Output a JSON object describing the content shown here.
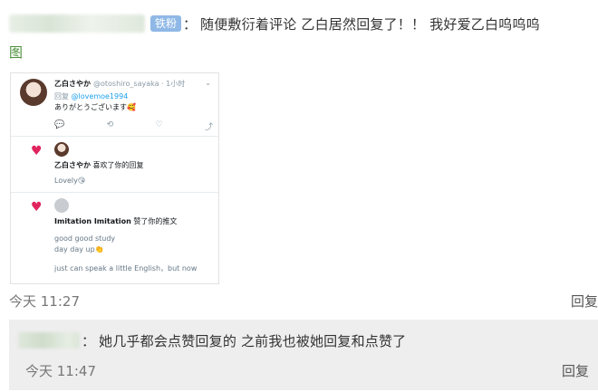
{
  "comment": {
    "badge": "铁粉",
    "colon": "：",
    "text": "随便敷衍着评论 乙白居然回复了！！ 我好爱乙白呜呜呜",
    "pic_link": "图",
    "time": "今天 11:27",
    "reply_label": "回复"
  },
  "tweet": {
    "name": "乙白さやか",
    "handle": "@otoshiro_sayaka · 1小时",
    "chevron": "⌄",
    "reply_prefix": "回复",
    "reply_to": "@lovemoe1994",
    "message": "ありがとうございます🥰",
    "actions": [
      "💬",
      "⟲",
      "♡",
      "⤴"
    ]
  },
  "notifications": [
    {
      "name": "乙白さやか",
      "action": " 喜欢了你的回复",
      "lines": [
        "Lovely😘"
      ]
    },
    {
      "name": "Imitation Imitation",
      "action": " 赞了你的推文",
      "lines": [
        "good good study",
        "day day up👏",
        "just can speak a little English，but now"
      ]
    }
  ],
  "sub_reply": {
    "colon": "：",
    "text": "她几乎都会点赞回复的 之前我也被她回复和点赞了",
    "time": "今天 11:47",
    "reply_label": "回复"
  }
}
